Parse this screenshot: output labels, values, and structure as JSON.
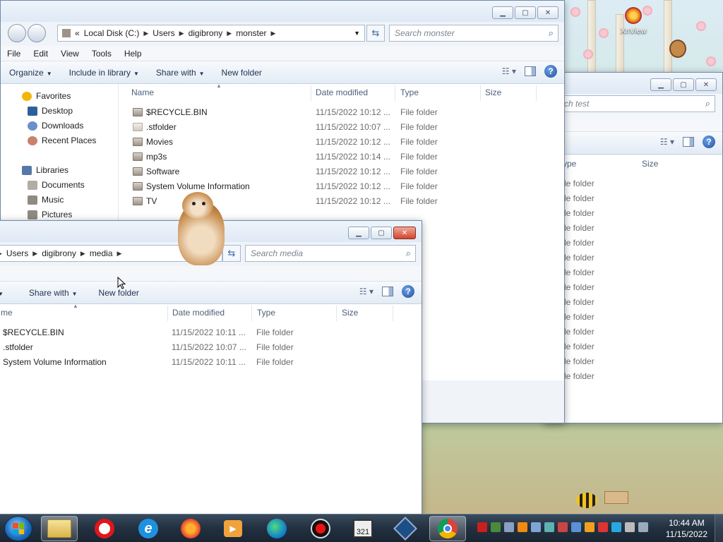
{
  "desktop": {
    "icons": [
      {
        "label": "XnView",
        "icon": "xnview-icon"
      }
    ]
  },
  "window_monster": {
    "address": {
      "overflow": "«",
      "crumbs": [
        "Local Disk (C:)",
        "Users",
        "digibrony",
        "monster"
      ]
    },
    "search_placeholder": "Search monster",
    "menu": [
      "File",
      "Edit",
      "View",
      "Tools",
      "Help"
    ],
    "toolbar": {
      "organize": "Organize",
      "include_in_library": "Include in library",
      "share_with": "Share with",
      "new_folder": "New folder"
    },
    "nav": {
      "favorites": "Favorites",
      "favorites_items": [
        "Desktop",
        "Downloads",
        "Recent Places"
      ],
      "libraries": "Libraries",
      "libraries_items": [
        "Documents",
        "Music",
        "Pictures"
      ]
    },
    "columns": {
      "name": "Name",
      "date": "Date modified",
      "type": "Type",
      "size": "Size"
    },
    "files": [
      {
        "name": "$RECYCLE.BIN",
        "date": "11/15/2022 10:12 ...",
        "type": "File folder",
        "size": ""
      },
      {
        "name": ".stfolder",
        "date": "11/15/2022 10:07 ...",
        "type": "File folder",
        "size": ""
      },
      {
        "name": "Movies",
        "date": "11/15/2022 10:12 ...",
        "type": "File folder",
        "size": ""
      },
      {
        "name": "mp3s",
        "date": "11/15/2022 10:14 ...",
        "type": "File folder",
        "size": ""
      },
      {
        "name": "Software",
        "date": "11/15/2022 10:12 ...",
        "type": "File folder",
        "size": ""
      },
      {
        "name": "System Volume Information",
        "date": "11/15/2022 10:12 ...",
        "type": "File folder",
        "size": ""
      },
      {
        "name": "TV",
        "date": "11/15/2022 10:12 ...",
        "type": "File folder",
        "size": ""
      }
    ]
  },
  "window_test": {
    "search_placeholder_partial": "rch test",
    "columns": {
      "type_partial": "ype",
      "size": "Size"
    },
    "type_partial": [
      "le folder",
      "le folder",
      "le folder",
      "le folder",
      "le folder",
      "le folder",
      "le folder",
      "le folder",
      "le folder",
      "le folder",
      "le folder",
      "le folder",
      "le folder",
      "le folder"
    ]
  },
  "window_media": {
    "address": {
      "crumbs": [
        "Users",
        "digibrony",
        "media"
      ]
    },
    "search_placeholder": "Search media",
    "toolbar": {
      "share_with": "Share with",
      "new_folder": "New folder"
    },
    "columns": {
      "name_partial": "me",
      "date": "Date modified",
      "type": "Type",
      "size": "Size"
    },
    "files": [
      {
        "name": "$RECYCLE.BIN",
        "date": "11/15/2022 10:11 ...",
        "type": "File folder"
      },
      {
        "name": ".stfolder",
        "date": "11/15/2022 10:07 ...",
        "type": "File folder"
      },
      {
        "name": "System Volume Information",
        "date": "11/15/2022 10:11 ...",
        "type": "File folder"
      }
    ]
  },
  "taskbar": {
    "apps": [
      "Windows Explorer",
      "Opera",
      "Internet Explorer",
      "Firefox",
      "Media Player",
      "Edge",
      "OBS",
      "Clapper",
      "VirtualBox",
      "Chrome"
    ],
    "clock_time": "10:44 AM",
    "clock_date": "11/15/2022"
  },
  "colors": {
    "taskbar": "#22303f",
    "titlebar": "#dfe9f5",
    "close_button": "#d2452b",
    "selection_accent": "#3c6aa5"
  }
}
